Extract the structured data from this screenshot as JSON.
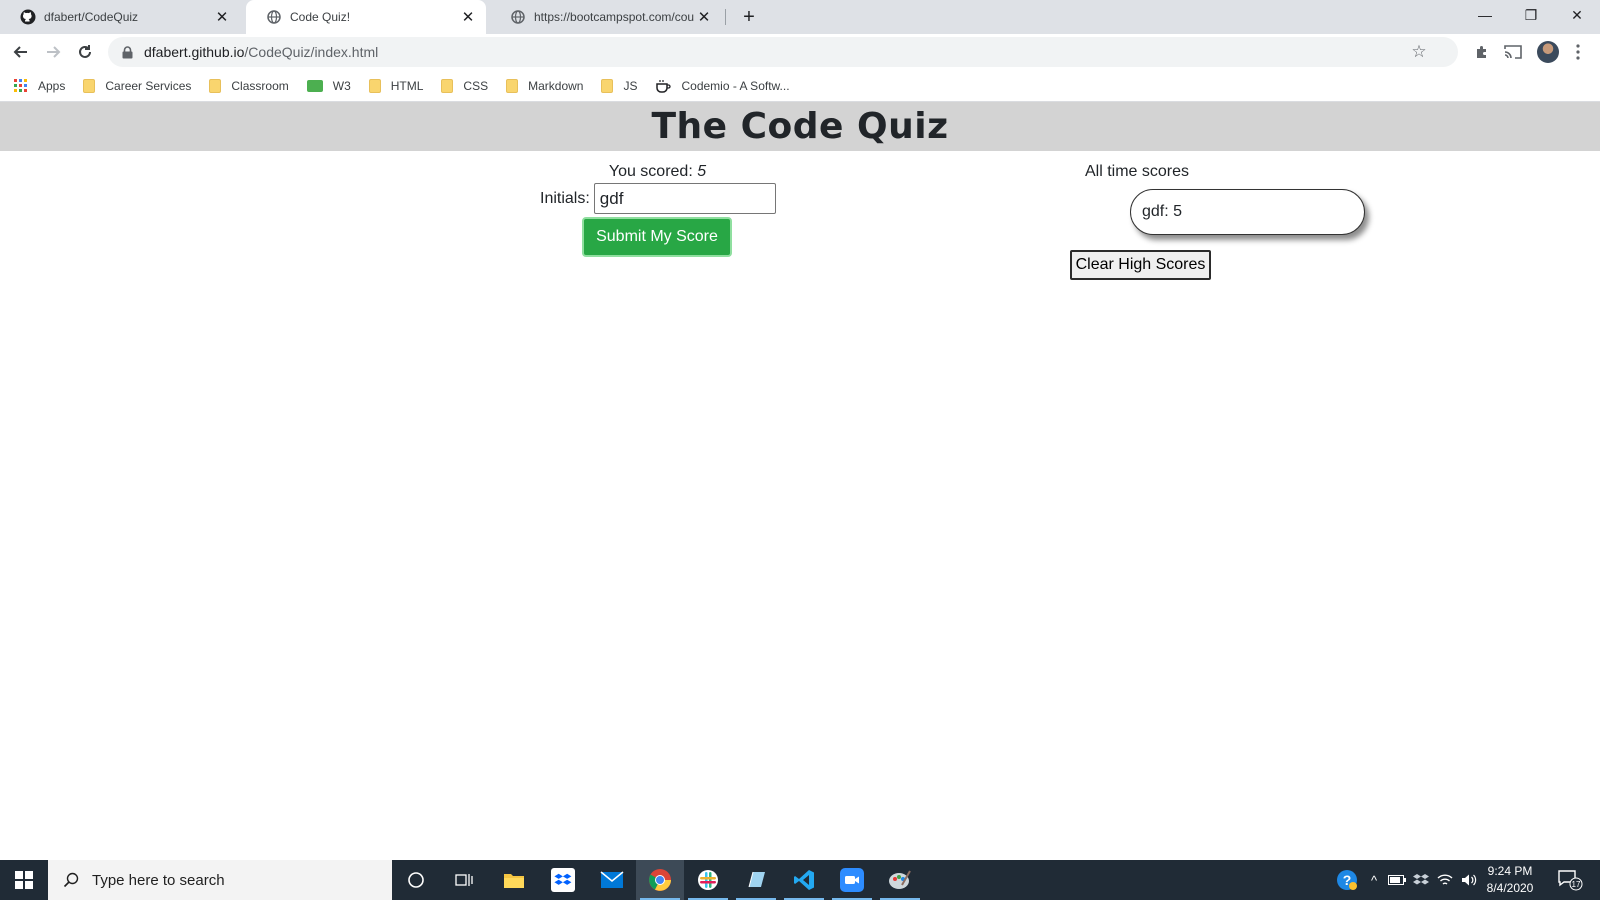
{
  "browser": {
    "tabs": [
      {
        "title": "dfabert/CodeQuiz",
        "icon": "github-icon",
        "active": false
      },
      {
        "title": "Code Quiz!",
        "icon": "globe-icon",
        "active": true
      },
      {
        "title": "https://bootcampspot.com/cours",
        "icon": "globe-icon",
        "active": false
      }
    ],
    "new_tab_label": "+",
    "url_host": "dfabert.github.io",
    "url_path": "/CodeQuiz/index.html",
    "bookmarks": [
      {
        "label": "Apps",
        "icon": "apps-grid-icon"
      },
      {
        "label": "Career Services",
        "icon": "folder-icon"
      },
      {
        "label": "Classroom",
        "icon": "folder-icon"
      },
      {
        "label": "W3",
        "icon": "w3schools-icon"
      },
      {
        "label": "HTML",
        "icon": "folder-icon"
      },
      {
        "label": "CSS",
        "icon": "folder-icon"
      },
      {
        "label": "Markdown",
        "icon": "folder-icon"
      },
      {
        "label": "JS",
        "icon": "folder-icon"
      },
      {
        "label": "Codemio - A Softw...",
        "icon": "coffee-cup-icon"
      }
    ]
  },
  "page": {
    "title": "The Code Quiz",
    "score_label": "You scored: ",
    "score_value": "5",
    "initials_label": "Initials:",
    "initials_value": "gdf",
    "submit_label": "Submit My Score",
    "alltime_label": "All time scores",
    "scores": [
      "gdf: 5"
    ],
    "clear_label": "Clear High Scores"
  },
  "taskbar": {
    "search_placeholder": "Type here to search",
    "time": "9:24 PM",
    "date": "8/4/2020",
    "notification_count": "17"
  },
  "colors": {
    "header_bg": "#d3d3d3",
    "submit_green": "#28a745",
    "taskbar_bg": "#202b36"
  }
}
